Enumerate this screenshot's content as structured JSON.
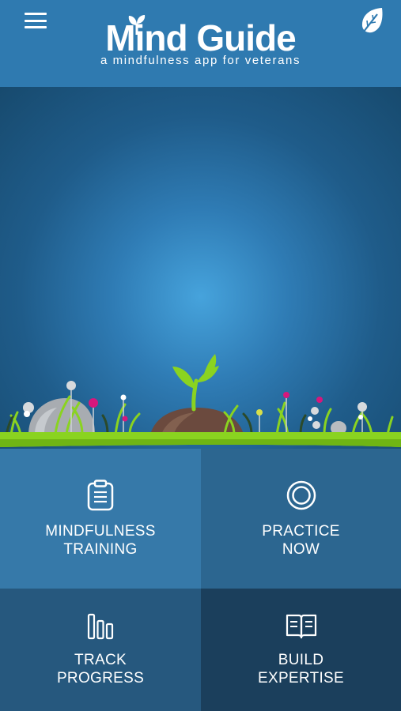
{
  "header": {
    "title": "Mind Guide",
    "tagline": "a mindfulness app for veterans",
    "menu_icon": "hamburger-menu-icon",
    "right_icon": "leaf-icon"
  },
  "tiles": [
    {
      "icon": "clipboard-icon",
      "line1": "MINDFULNESS",
      "line2": "TRAINING"
    },
    {
      "icon": "target-circle-icon",
      "line1": "PRACTICE",
      "line2": "NOW"
    },
    {
      "icon": "bar-chart-icon",
      "line1": "TRACK",
      "line2": "PROGRESS"
    },
    {
      "icon": "open-book-icon",
      "line1": "BUILD",
      "line2": "EXPERTISE"
    }
  ],
  "colors": {
    "header": "#2f7ab0",
    "grass": "#8ad320",
    "tile_training": "#3679a9",
    "tile_practice": "#2c6690",
    "tile_progress": "#26587e",
    "tile_expertise": "#1b3f5c"
  }
}
